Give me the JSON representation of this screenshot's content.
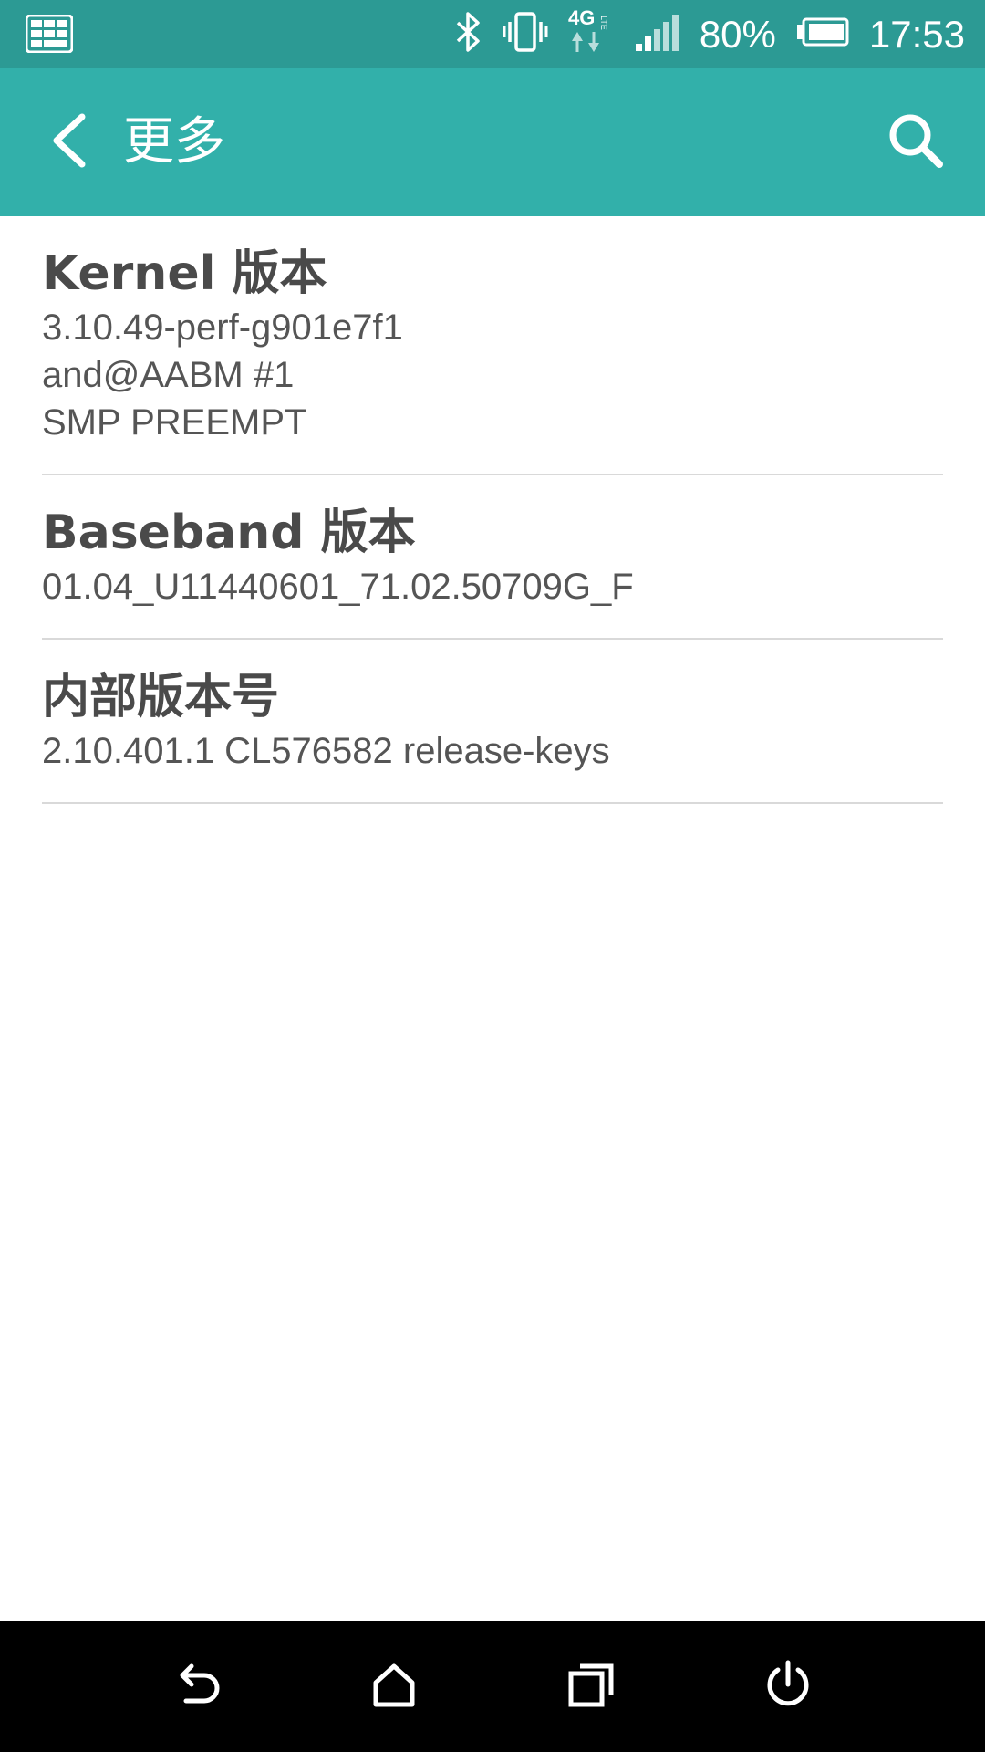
{
  "status_bar": {
    "battery_percent": "80%",
    "time": "17:53",
    "network": "4G",
    "icons": [
      "notification-keyboard-icon",
      "bluetooth-icon",
      "vibrate-icon",
      "lte-4g-icon",
      "signal-icon",
      "battery-icon"
    ]
  },
  "app_bar": {
    "title": "更多",
    "back_icon": "back-chevron-icon",
    "search_icon": "search-icon"
  },
  "items": [
    {
      "title": "Kernel 版本",
      "value": "3.10.49-perf-g901e7f1\nand@AABM #1\nSMP PREEMPT"
    },
    {
      "title": "Baseband 版本",
      "value": "01.04_U11440601_71.02.50709G_F"
    },
    {
      "title": "内部版本号",
      "value": "2.10.401.1 CL576582 release-keys"
    }
  ],
  "nav_bar": {
    "icons": [
      "back-icon",
      "home-icon",
      "recents-icon",
      "power-icon"
    ]
  },
  "colors": {
    "status_bar": "#2c9a94",
    "app_bar": "#32b0aa",
    "divider": "#d9d9d9",
    "nav_bar": "#000000"
  }
}
